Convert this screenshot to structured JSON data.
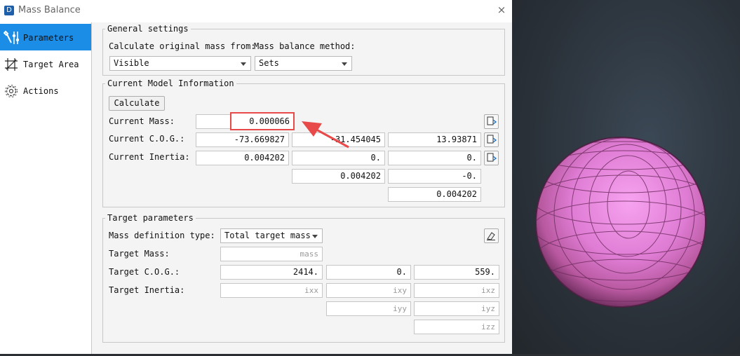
{
  "window": {
    "title": "Mass Balance",
    "close_glyph": "×",
    "app_icon": "logo-icon"
  },
  "sidebar": {
    "items": [
      {
        "label": "Parameters",
        "icon": "wrench-sliders-icon",
        "active": true
      },
      {
        "label": "Target Area",
        "icon": "target-grid-icon",
        "active": false
      },
      {
        "label": "Actions",
        "icon": "gear-icon",
        "active": false
      }
    ]
  },
  "general": {
    "title": "General settings",
    "calc_label": "Calculate original mass from:",
    "calc_value": "Visible",
    "method_label": "Mass balance method:",
    "method_value": "Sets"
  },
  "current": {
    "title": "Current Model Information",
    "calculate_button": "Calculate",
    "mass_label": "Current Mass:",
    "mass_value": "0.000066",
    "cog_label": "Current C.O.G.:",
    "cog": [
      "-73.669827",
      "-31.454045",
      "13.93871"
    ],
    "inertia_label": "Current Inertia:",
    "inertia": [
      "0.004202",
      "0.",
      "0.",
      "0.004202",
      "-0.",
      "0.004202"
    ]
  },
  "target": {
    "title": "Target parameters",
    "definition_label": "Mass definition type:",
    "definition_value": "Total target mass",
    "mass_label": "Target Mass:",
    "mass_placeholder": "mass",
    "cog_label": "Target C.O.G.:",
    "cog": [
      "2414.",
      "0.",
      "559."
    ],
    "inertia_label": "Target Inertia:",
    "inertia_placeholders": [
      "ixx",
      "ixy",
      "ixz",
      "iyy",
      "iyz",
      "izz"
    ]
  },
  "colors": {
    "accent": "#1c8de6",
    "highlight": "#e84a4a",
    "sphere": "#e07ad6"
  }
}
